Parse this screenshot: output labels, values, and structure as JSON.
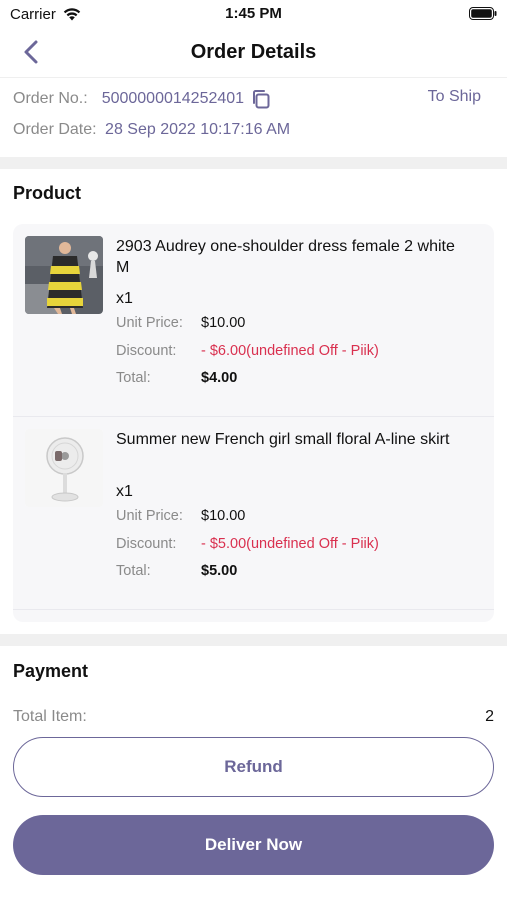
{
  "status_bar": {
    "carrier": "Carrier",
    "time": "1:45 PM"
  },
  "nav": {
    "title": "Order Details",
    "back_icon": "chevron-left-icon"
  },
  "order": {
    "number_label": "Order No.:",
    "number_value": "5000000014252401",
    "copy_icon": "copy-icon",
    "status": "To Ship",
    "date_label": "Order Date:",
    "date_value": "28 Sep 2022 10:17:16 AM"
  },
  "product_section": {
    "title": "Product",
    "items": [
      {
        "name": "2903 Audrey one-shoulder dress female 2 white M",
        "qty": "x1",
        "unit_price_label": "Unit Price:",
        "unit_price": "$10.00",
        "discount_label": "Discount:",
        "discount": "- $6.00(undefined Off - Piik)",
        "total_label": "Total:",
        "total": "$4.00",
        "thumb_icon": "dress-photo"
      },
      {
        "name": "Summer new French girl small floral A-line skirt",
        "qty": "x1",
        "unit_price_label": "Unit Price:",
        "unit_price": "$10.00",
        "discount_label": "Discount:",
        "discount": "- $5.00(undefined Off - Piik)",
        "total_label": "Total:",
        "total": "$5.00",
        "thumb_icon": "fan-photo"
      }
    ]
  },
  "payment": {
    "title": "Payment",
    "total_item_label": "Total Item:",
    "total_item_value": "2"
  },
  "actions": {
    "refund_label": "Refund",
    "deliver_label": "Deliver Now"
  },
  "colors": {
    "accent": "#6c6799",
    "discount": "#d9304f",
    "muted": "#8a8a8a",
    "divider": "#f0f0f0"
  }
}
